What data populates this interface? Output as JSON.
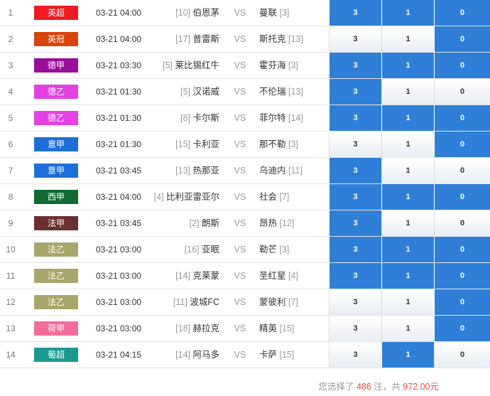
{
  "colors": {
    "selected": "#2f7fd8",
    "highlight": "#e84c3d"
  },
  "matches": [
    {
      "num": "1",
      "league": "英超",
      "league_color": "#ee1b24",
      "time": "03-21 04:00",
      "home_rank": "[10]",
      "home": "伯恩茅",
      "vs": "VS",
      "away": "曼联",
      "away_rank": "[3]",
      "opts": [
        "3",
        "1",
        "0"
      ],
      "sel": [
        true,
        true,
        true
      ]
    },
    {
      "num": "2",
      "league": "英冠",
      "league_color": "#d9430c",
      "time": "03-21 04:00",
      "home_rank": "[17]",
      "home": "普雷斯",
      "vs": "VS",
      "away": "斯托克",
      "away_rank": "[13]",
      "opts": [
        "3",
        "1",
        "0"
      ],
      "sel": [
        false,
        false,
        true
      ]
    },
    {
      "num": "3",
      "league": "德甲",
      "league_color": "#990d99",
      "time": "03-21 03:30",
      "home_rank": "[5]",
      "home": "莱比锡红牛",
      "vs": "VS",
      "away": "霍芬海",
      "away_rank": "[3]",
      "opts": [
        "3",
        "1",
        "0"
      ],
      "sel": [
        true,
        true,
        true
      ]
    },
    {
      "num": "4",
      "league": "德乙",
      "league_color": "#e341e3",
      "time": "03-21 01:30",
      "home_rank": "[5]",
      "home": "汉诺威",
      "vs": "VS",
      "away": "不伦瑞",
      "away_rank": "[13]",
      "opts": [
        "3",
        "1",
        "0"
      ],
      "sel": [
        true,
        false,
        false
      ]
    },
    {
      "num": "5",
      "league": "德乙",
      "league_color": "#e341e3",
      "time": "03-21 01:30",
      "home_rank": "[8]",
      "home": "卡尔斯",
      "vs": "VS",
      "away": "菲尔特",
      "away_rank": "[14]",
      "opts": [
        "3",
        "1",
        "0"
      ],
      "sel": [
        true,
        true,
        true
      ]
    },
    {
      "num": "6",
      "league": "意甲",
      "league_color": "#1d6fd7",
      "time": "03-21 01:30",
      "home_rank": "[15]",
      "home": "卡利亚",
      "vs": "VS",
      "away": "那不勒",
      "away_rank": "[3]",
      "opts": [
        "3",
        "1",
        "0"
      ],
      "sel": [
        false,
        false,
        true
      ]
    },
    {
      "num": "7",
      "league": "意甲",
      "league_color": "#1d6fd7",
      "time": "03-21 03:45",
      "home_rank": "[13]",
      "home": "热那亚",
      "vs": "VS",
      "away": "乌迪内",
      "away_rank": "[11]",
      "opts": [
        "3",
        "1",
        "0"
      ],
      "sel": [
        true,
        false,
        false
      ]
    },
    {
      "num": "8",
      "league": "西甲",
      "league_color": "#0f6b32",
      "time": "03-21 04:00",
      "home_rank": "[4]",
      "home": "比利亚雷亚尔",
      "vs": "VS",
      "away": "社会",
      "away_rank": "[7]",
      "opts": [
        "3",
        "1",
        "0"
      ],
      "sel": [
        true,
        true,
        true
      ]
    },
    {
      "num": "9",
      "league": "法甲",
      "league_color": "#6b2f2f",
      "time": "03-21 03:45",
      "home_rank": "[2]",
      "home": "朗斯",
      "vs": "VS",
      "away": "昂热",
      "away_rank": "[12]",
      "opts": [
        "3",
        "1",
        "0"
      ],
      "sel": [
        true,
        false,
        false
      ]
    },
    {
      "num": "10",
      "league": "法乙",
      "league_color": "#a8a66a",
      "time": "03-21 03:00",
      "home_rank": "[16]",
      "home": "亚眠",
      "vs": "VS",
      "away": "勒芒",
      "away_rank": "[3]",
      "opts": [
        "3",
        "1",
        "0"
      ],
      "sel": [
        true,
        true,
        true
      ]
    },
    {
      "num": "11",
      "league": "法乙",
      "league_color": "#a8a66a",
      "time": "03-21 03:00",
      "home_rank": "[14]",
      "home": "克莱蒙",
      "vs": "VS",
      "away": "圣红星",
      "away_rank": "[4]",
      "opts": [
        "3",
        "1",
        "0"
      ],
      "sel": [
        true,
        true,
        true
      ]
    },
    {
      "num": "12",
      "league": "法乙",
      "league_color": "#a8a66a",
      "time": "03-21 03:00",
      "home_rank": "[11]",
      "home": "波城FC",
      "vs": "VS",
      "away": "蒙彼利",
      "away_rank": "[7]",
      "opts": [
        "3",
        "1",
        "0"
      ],
      "sel": [
        false,
        false,
        true
      ]
    },
    {
      "num": "13",
      "league": "荷甲",
      "league_color": "#f36c9b",
      "time": "03-21 03:00",
      "home_rank": "[18]",
      "home": "赫拉克",
      "vs": "VS",
      "away": "精英",
      "away_rank": "[15]",
      "opts": [
        "3",
        "1",
        "0"
      ],
      "sel": [
        false,
        false,
        true
      ]
    },
    {
      "num": "14",
      "league": "葡超",
      "league_color": "#1a9a8f",
      "time": "03-21 04:15",
      "home_rank": "[14]",
      "home": "阿马多",
      "vs": "VS",
      "away": "卡萨",
      "away_rank": "[15]",
      "opts": [
        "3",
        "1",
        "0"
      ],
      "sel": [
        false,
        true,
        false
      ]
    }
  ],
  "summary": {
    "prefix": "您选择了 ",
    "count": "486",
    "middle": " 注，共 ",
    "amount": "972.00元"
  }
}
